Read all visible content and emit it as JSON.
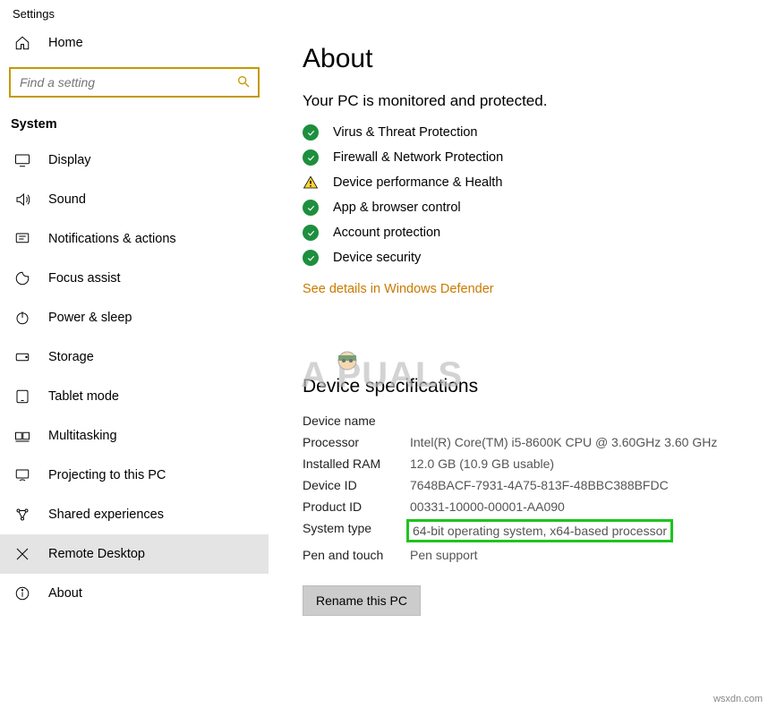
{
  "window": {
    "title": "Settings"
  },
  "sidebar": {
    "home": "Home",
    "search_placeholder": "Find a setting",
    "section": "System",
    "items": [
      {
        "label": "Display"
      },
      {
        "label": "Sound"
      },
      {
        "label": "Notifications & actions"
      },
      {
        "label": "Focus assist"
      },
      {
        "label": "Power & sleep"
      },
      {
        "label": "Storage"
      },
      {
        "label": "Tablet mode"
      },
      {
        "label": "Multitasking"
      },
      {
        "label": "Projecting to this PC"
      },
      {
        "label": "Shared experiences"
      },
      {
        "label": "Remote Desktop"
      },
      {
        "label": "About"
      }
    ]
  },
  "main": {
    "title": "About",
    "protection_heading": "Your PC is monitored and protected.",
    "status": [
      {
        "icon": "check",
        "label": "Virus & Threat Protection"
      },
      {
        "icon": "check",
        "label": "Firewall & Network Protection"
      },
      {
        "icon": "warn",
        "label": "Device performance & Health"
      },
      {
        "icon": "check",
        "label": "App & browser control"
      },
      {
        "icon": "check",
        "label": "Account protection"
      },
      {
        "icon": "check",
        "label": "Device security"
      }
    ],
    "defender_link": "See details in Windows Defender",
    "watermark": "A  PUALS",
    "spec_heading": "Device specifications",
    "specs": {
      "device_name_label": "Device name",
      "device_name_value": "",
      "processor_label": "Processor",
      "processor_value": "Intel(R) Core(TM) i5-8600K CPU @ 3.60GHz   3.60 GHz",
      "ram_label": "Installed RAM",
      "ram_value": "12.0 GB (10.9 GB usable)",
      "device_id_label": "Device ID",
      "device_id_value": "7648BACF-7931-4A75-813F-48BBC388BFDC",
      "product_id_label": "Product ID",
      "product_id_value": "00331-10000-00001-AA090",
      "system_type_label": "System type",
      "system_type_value": "64-bit operating system, x64-based processor",
      "pen_label": "Pen and touch",
      "pen_value": "Pen support"
    },
    "rename_button": "Rename this PC"
  },
  "corner": "wsxdn.com"
}
